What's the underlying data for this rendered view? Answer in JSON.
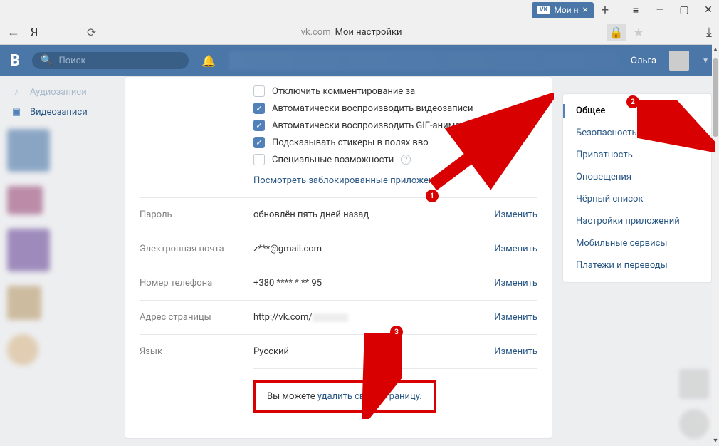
{
  "browser": {
    "tab_title": "Мои н",
    "tab_badge": "VK",
    "url_host": "vk.com",
    "url_title": "Мои настройки"
  },
  "header": {
    "search_placeholder": "Поиск",
    "username": "Ольга"
  },
  "left_nav": {
    "item_audio": "Аудиозаписи",
    "item_video": "Видеозаписи"
  },
  "checkboxes": {
    "disable_comments": "Отключить комментирование за",
    "autoplay_video": "Автоматически воспроизводить видеозаписи",
    "autoplay_gif": "Автоматически воспроизводить GIF-анимации",
    "sticker_hints": "Подсказывать стикеры в полях вво",
    "accessibility": "Специальные возможности"
  },
  "blocked_apps_link": "Посмотреть заблокированные приложения",
  "rows": {
    "password": {
      "label": "Пароль",
      "value": "обновлён пять дней назад",
      "action": "Изменить"
    },
    "email": {
      "label": "Электронная почта",
      "value": "z***@gmail.com",
      "action": "Изменить"
    },
    "phone": {
      "label": "Номер телефона",
      "value": "+380 **** * ** 95",
      "action": "Изменить"
    },
    "address": {
      "label": "Адрес страницы",
      "value": "http://vk.com/",
      "action": "Изменить"
    },
    "language": {
      "label": "Язык",
      "value": "Русский",
      "action": "Изменить"
    }
  },
  "delete": {
    "prefix": "Вы можете ",
    "link": "удалить свою страницу."
  },
  "sidebar": {
    "general": "Общее",
    "security": "Безопасность",
    "privacy": "Приватность",
    "notifications": "Оповещения",
    "blacklist": "Чёрный список",
    "apps": "Настройки приложений",
    "mobile": "Мобильные сервисы",
    "payments": "Платежи и переводы"
  },
  "annotations": {
    "n1": "1",
    "n2": "2",
    "n3": "3"
  }
}
